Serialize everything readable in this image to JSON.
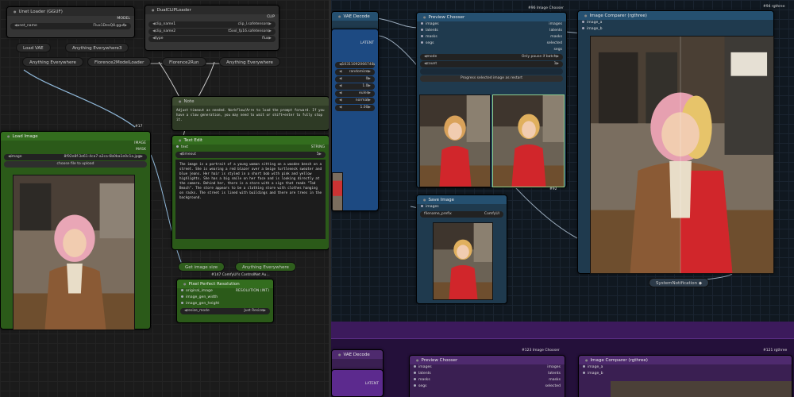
{
  "left": {
    "unet_loader": {
      "title": "Unet Loader (GGUF)",
      "output": "MODEL",
      "field_label": "unet_name",
      "field_value": "Flux1DevQ8.gguf"
    },
    "clip_loader": {
      "title": "DualCLIPLoader",
      "output": "CLIP",
      "fields": [
        {
          "label": "clip_name1",
          "value": "clip_l.safetensors"
        },
        {
          "label": "clip_name2",
          "value": "t5xxl_fp16.safetensors"
        },
        {
          "label": "type",
          "value": "flux"
        }
      ]
    },
    "load_vae": {
      "label": "Load VAE"
    },
    "anything_everywhere3": {
      "label": "Anything Everywhere3"
    },
    "anything_everywhere_1": {
      "label": "Anything Everywhere"
    },
    "florence_loader": {
      "label": "Florence2ModelLoader"
    },
    "florence_run": {
      "label": "Florence2Run"
    },
    "anything_everywhere_2": {
      "label": "Anything Everywhere"
    },
    "note": {
      "title": "Note",
      "text": "Adjust timeout as needed. Workflow/Arre to load the prompt forward. If you have a slow generation, you may need to wait or shift+enter to fully stop it."
    },
    "text_edit": {
      "title": "Text Edit",
      "row1": "text",
      "row1_out": "STRING",
      "field_label": "timeout",
      "field_value": "5",
      "text": "The image is a portrait of a young woman sitting on a wooden bench on a street. She is wearing a red blazer over a beige turtleneck sweater and blue jeans. Her hair is styled in a short bob with pink and yellow highlights. She has a big smile on her face and is looking directly at the camera. Behind her, there is a store with a sign that reads \"Tod Beach\". The store appears to be a clothing store with clothes hanging on racks. The street is lined with buildings and there are trees in the background."
    },
    "load_image": {
      "title": "Load Image",
      "out1": "IMAGE",
      "out2": "MASK",
      "field_label": "image",
      "field_value": "8f92e8f-3e61-4ca7-a2ca-6b0ba1e0c1a.jpg",
      "upload": "choose file to upload",
      "badge": "#17"
    },
    "get_image_size": {
      "label": "Get image size"
    },
    "anything_everywhere_3": {
      "label": "Anything Everywhere"
    },
    "pixel_perfect": {
      "badge": "#147 ComfyUI's ControlNet Au...",
      "title": "Pixel Perfect Resolution",
      "rows": [
        {
          "label": "original_image",
          "value": "RESOLUTION (INT)"
        },
        {
          "label": "image_gen_width",
          "value": ""
        },
        {
          "label": "image_gen_height",
          "value": ""
        }
      ],
      "field_label": "resize_mode",
      "field_value": "Just Resize"
    }
  },
  "right": {
    "vae_decode": {
      "title": "VAE Decode",
      "badge": "#98",
      "out": "LATENT",
      "values": [
        "10311092066748",
        "randomize",
        "0",
        "1.0",
        "euler",
        "normal",
        "1.00"
      ]
    },
    "preview_chooser": {
      "badge": "#96 Image Chooser",
      "title": "Preview Chooser",
      "inputs": [
        "images",
        "latents",
        "masks",
        "segs"
      ],
      "outputs": [
        "images",
        "latents",
        "masks",
        "selected",
        "segs"
      ],
      "mode_label": "mode",
      "mode_value": "Only pause if batch",
      "count_label": "count",
      "count_value": "1",
      "button": "Progress selected image as restart",
      "img_badge": "#92"
    },
    "save_image": {
      "title": "Save Image",
      "input": "images",
      "field_label": "filename_prefix",
      "field_value": "ComfyUI"
    },
    "image_comparer": {
      "badge": "#94 rgthree",
      "title": "Image Comparer (rgthree)",
      "inputs": [
        "image_a",
        "image_b"
      ]
    },
    "system_notification": {
      "label": "SystemNotification"
    },
    "vae_decode_2": {
      "title": "VAE Decode",
      "badge": "#117",
      "out": "LATENT"
    },
    "preview_chooser_2": {
      "badge": "#123 Image Chooser",
      "title": "Preview Chooser",
      "inputs": [
        "images",
        "latents",
        "masks",
        "segs"
      ],
      "outputs": [
        "images",
        "latents",
        "masks",
        "selected"
      ]
    },
    "image_comparer_2": {
      "badge": "#121 rgthree",
      "title": "Image Comparer (rgthree)",
      "inputs": [
        "image_a",
        "image_b"
      ]
    }
  }
}
